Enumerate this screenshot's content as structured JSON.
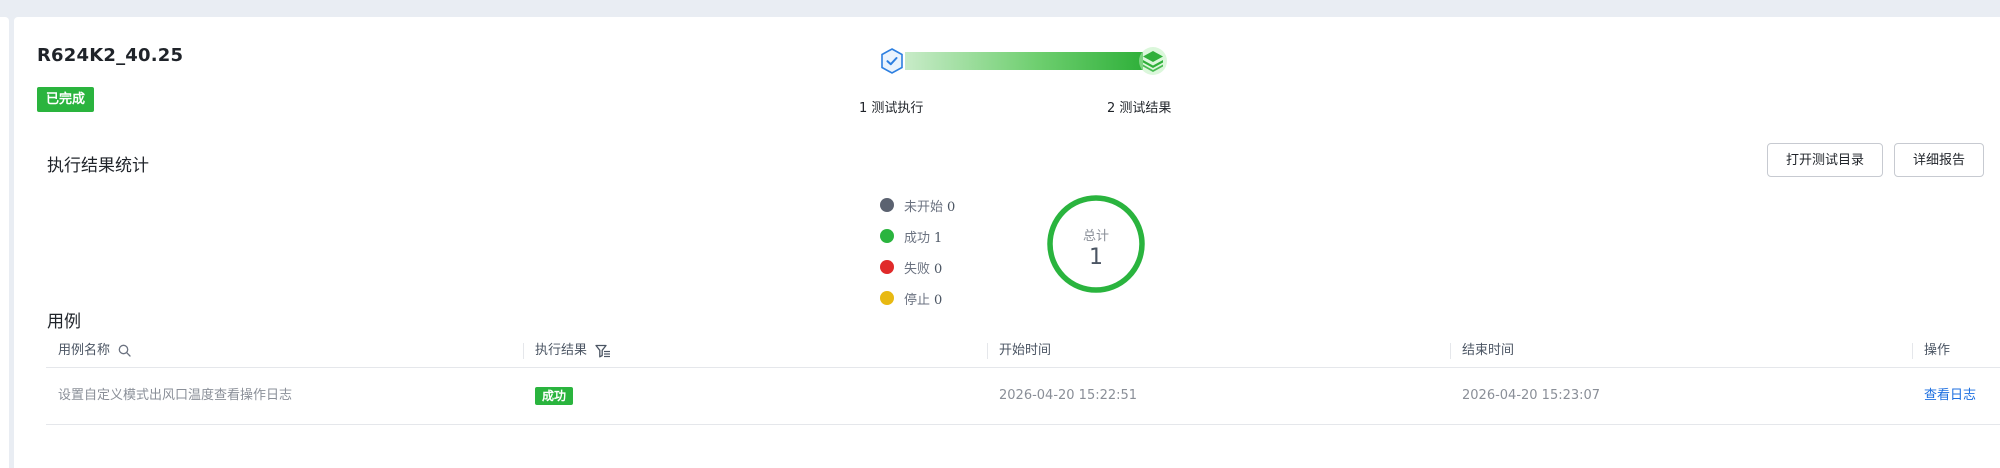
{
  "project": {
    "title": "R624K2_40.25",
    "status": "已完成"
  },
  "stepper": {
    "steps": [
      {
        "label": "1 测试执行"
      },
      {
        "label": "2 测试结果"
      }
    ],
    "colors": {
      "bar_start": "#c8ebc8",
      "bar_end": "#2fb03a",
      "icon_blue": "#2d7fe0",
      "icon_green": "#2fb03a"
    }
  },
  "stats": {
    "title": "执行结果统计",
    "buttons": {
      "open_dir": "打开测试目录",
      "report": "详细报告"
    },
    "legend": [
      {
        "name": "未开始",
        "count": "0",
        "color": "#5b6270"
      },
      {
        "name": "成功",
        "count": "1",
        "color": "#2ab43e"
      },
      {
        "name": "失败",
        "count": "0",
        "color": "#e02a2a"
      },
      {
        "name": "停止",
        "count": "0",
        "color": "#e8b912"
      }
    ],
    "total_label": "总计",
    "total_value": "1",
    "ring_color": "#2ab43e"
  },
  "cases": {
    "title": "用例",
    "columns": [
      "用例名称",
      "执行结果",
      "开始时间",
      "结束时间",
      "操作"
    ],
    "rows": [
      {
        "name": "设置自定义模式出风口温度查看操作日志",
        "result": "成功",
        "start": "2026-04-20 15:22:51",
        "end": "2026-04-20 15:23:07",
        "action": "查看日志"
      }
    ]
  }
}
